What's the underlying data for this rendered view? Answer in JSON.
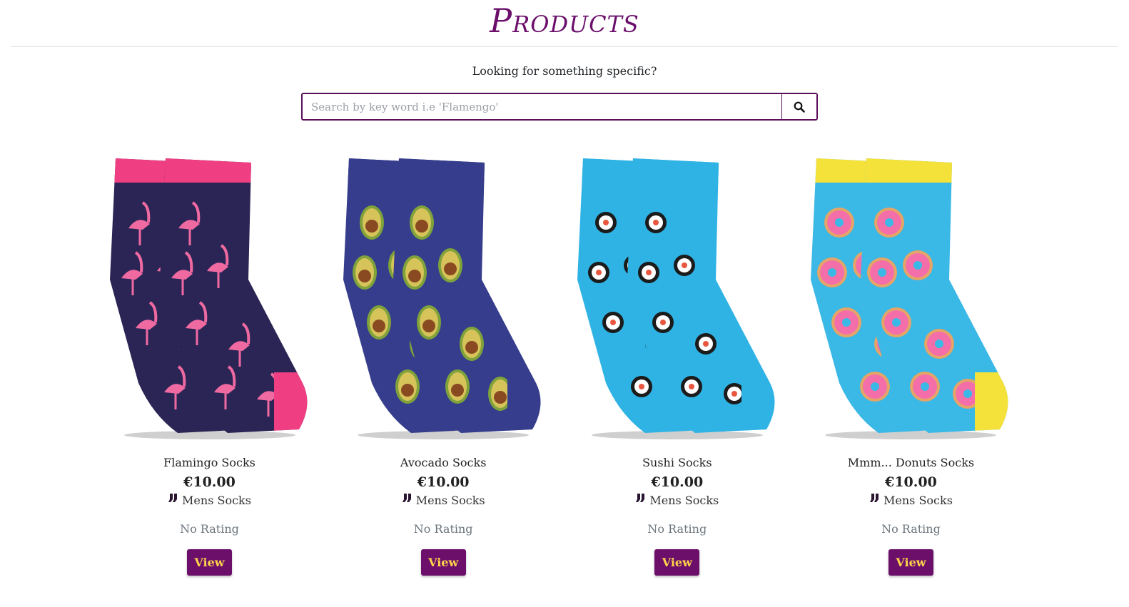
{
  "header": {
    "title": "Products"
  },
  "search": {
    "prompt": "Looking for something specific?",
    "placeholder": "Search by key word i.e 'Flamengo'",
    "button_icon": "search-icon"
  },
  "products": [
    {
      "name": "Flamingo Socks",
      "price": "€10.00",
      "category": "Mens Socks",
      "category_icon": "socks-icon",
      "rating": "No Rating",
      "button": "View",
      "colors": {
        "body": "#2b2555",
        "cuff": "#ef3f82",
        "motif": "#f06aa2"
      },
      "motif": "flamingo"
    },
    {
      "name": "Avocado Socks",
      "price": "€10.00",
      "category": "Mens Socks",
      "category_icon": "socks-icon",
      "rating": "No Rating",
      "button": "View",
      "colors": {
        "body": "#353d8c",
        "cuff": "#353d8c",
        "motif": "#d6c35a"
      },
      "motif": "avocado"
    },
    {
      "name": "Sushi Socks",
      "price": "€10.00",
      "category": "Mens Socks",
      "category_icon": "socks-icon",
      "rating": "No Rating",
      "button": "View",
      "colors": {
        "body": "#2fb3e4",
        "cuff": "#2fb3e4",
        "motif": "#ffffff"
      },
      "motif": "sushi"
    },
    {
      "name": "Mmm... Donuts Socks",
      "price": "€10.00",
      "category": "Mens Socks",
      "category_icon": "socks-icon",
      "rating": "No Rating",
      "button": "View",
      "colors": {
        "body": "#3ab8e6",
        "cuff": "#f4e23a",
        "motif": "#f46ea9"
      },
      "motif": "donut"
    }
  ]
}
